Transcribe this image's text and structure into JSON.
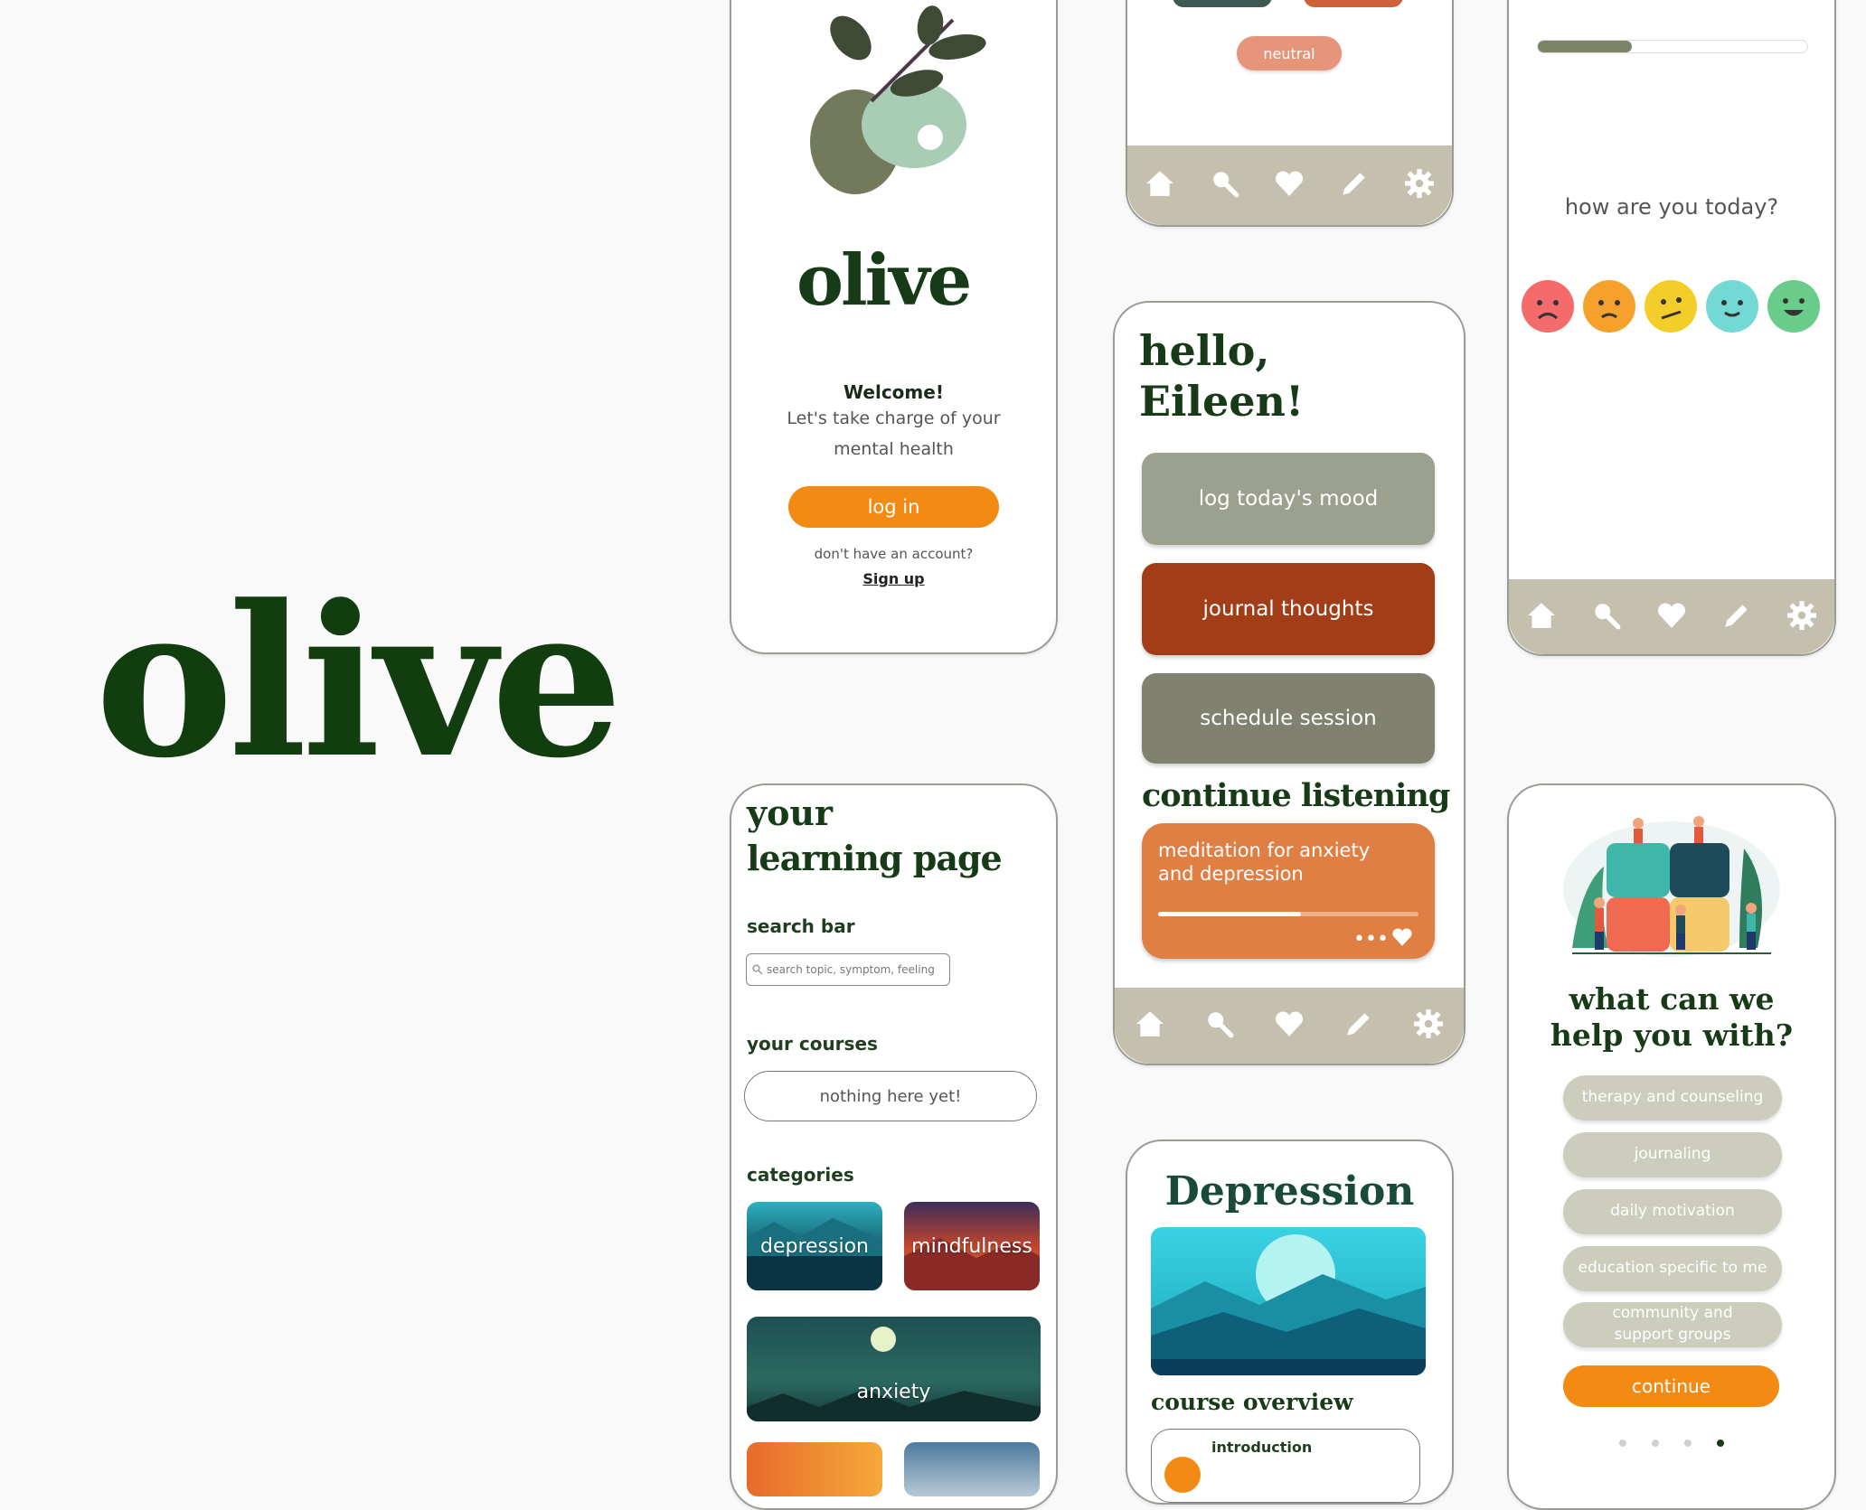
{
  "brand": {
    "name": "olive",
    "color": "#113d0f"
  },
  "welcome_screen": {
    "logo_text": "olive",
    "welcome_heading": "Welcome!",
    "welcome_line1": "Let's take charge of your",
    "welcome_line2": "mental health",
    "login_label": "log in",
    "no_account_text": "don't have an account?",
    "signup_label": "Sign up",
    "accent": "#f28a14"
  },
  "mood_picker_partial": {
    "neutral_label": "neutral"
  },
  "nav": {
    "icons": [
      "home-icon",
      "search-icon",
      "heart-icon",
      "pencil-icon",
      "gear-icon"
    ],
    "color": "#c5bfad"
  },
  "mood_screen": {
    "question": "how are you today?",
    "progress": 0.35,
    "moods": [
      "very-sad",
      "sad",
      "neutral",
      "content",
      "happy"
    ]
  },
  "home_screen": {
    "greeting_line1": "hello,",
    "greeting_line2": "Eileen!",
    "log_mood_label": "log today's mood",
    "journal_label": "journal thoughts",
    "schedule_label": "schedule session",
    "continue_heading": "continue listening",
    "track_title_line1": "meditation for anxiety",
    "track_title_line2": "and depression",
    "track_progress": 0.55
  },
  "learning_screen": {
    "title_line1": "your",
    "title_line2": "learning page",
    "search_heading": "search bar",
    "search_placeholder": "search topic, symptom, feeling",
    "courses_heading": "your courses",
    "courses_empty": "nothing here yet!",
    "categories_heading": "categories",
    "categories": [
      "depression",
      "mindfulness",
      "anxiety"
    ]
  },
  "depression_screen": {
    "title": "Depression",
    "overview_heading": "course overview",
    "first_lesson": "introduction"
  },
  "help_screen": {
    "question_line1": "what can we",
    "question_line2": "help you with?",
    "options": [
      "therapy and counseling",
      "journaling",
      "daily motivation",
      "education specific to me",
      "community and support groups"
    ],
    "continue_label": "continue",
    "page_dots": 4,
    "active_dot": 4
  }
}
